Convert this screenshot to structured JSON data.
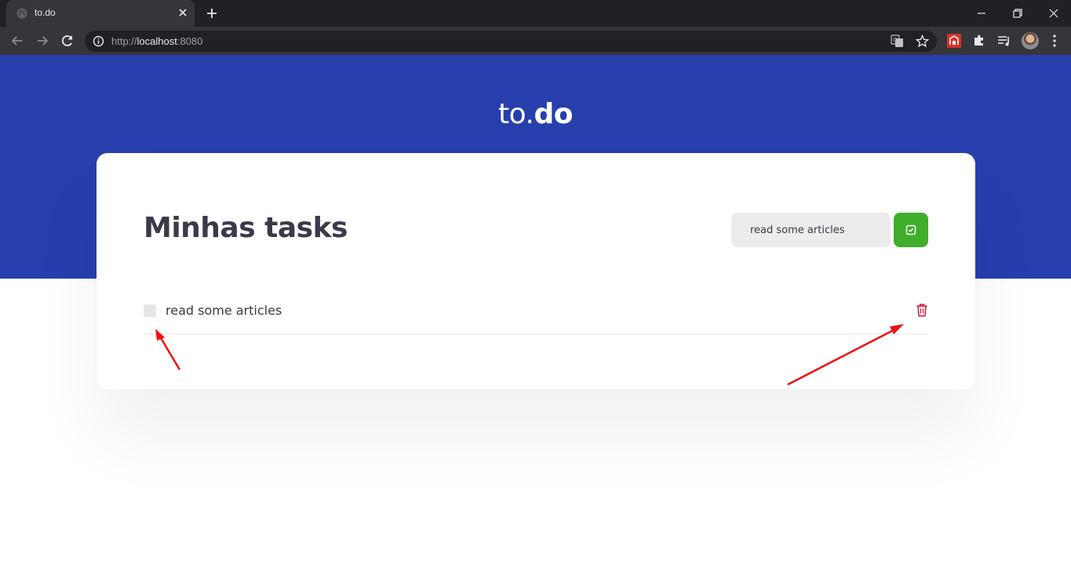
{
  "browser": {
    "tab_title": "to.do",
    "url_scheme": "http://",
    "url_host": "localhost",
    "url_port": ":8080",
    "icons": [
      "globe-icon",
      "close-icon",
      "plus-icon",
      "minimize-icon",
      "restore-icon",
      "close-window-icon",
      "back-icon",
      "forward-icon",
      "reload-icon",
      "info-icon",
      "translate-icon",
      "star-icon",
      "extension-icon",
      "puzzle-icon",
      "media-icon",
      "avatar",
      "menu-icon"
    ]
  },
  "header": {
    "brand_light": "to.",
    "brand_bold": "do"
  },
  "main": {
    "title": "Minhas tasks",
    "new_task_input_value": "read some articles",
    "add_button_icon": "check-square-icon"
  },
  "tasks": [
    {
      "text": "read some articles",
      "completed": false,
      "delete_icon": "trash-icon"
    }
  ],
  "colors": {
    "hero_bg": "#273fad",
    "add_button": "#3fae2a",
    "delete_icon": "#c8102e",
    "annotation_arrow": "#ee1111"
  }
}
